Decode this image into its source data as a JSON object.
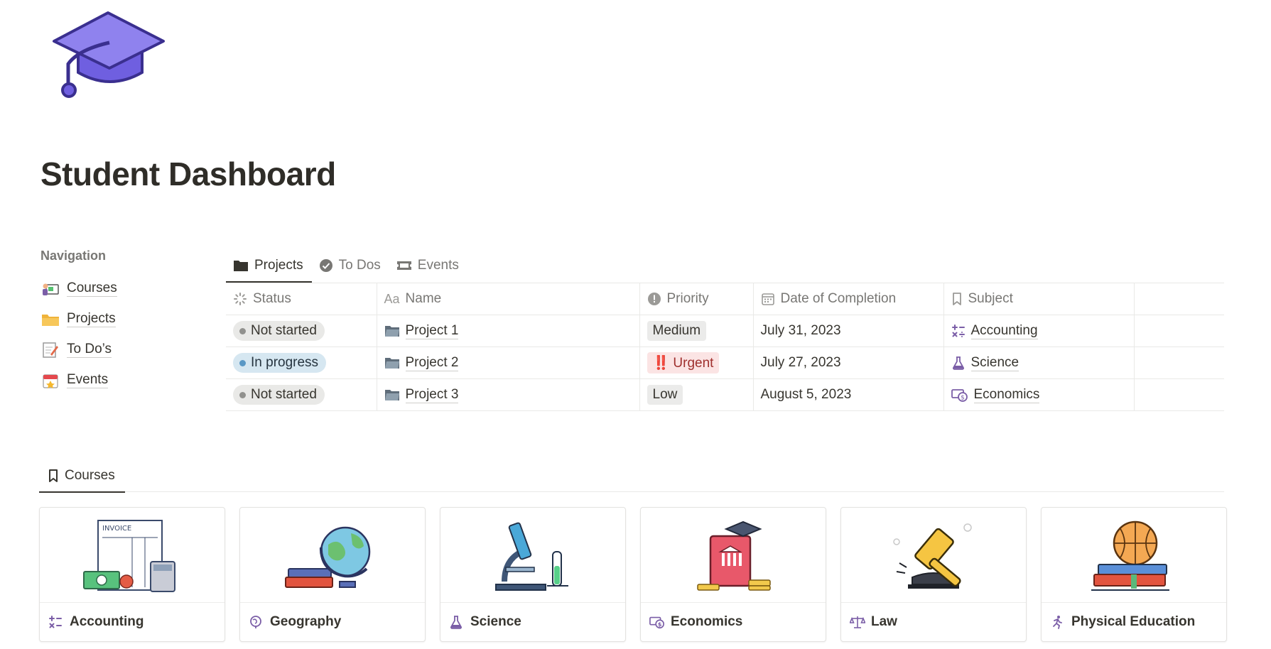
{
  "page": {
    "title": "Student Dashboard"
  },
  "navigation": {
    "heading": "Navigation",
    "items": [
      {
        "label": "Courses",
        "icon": "teacher-board-icon"
      },
      {
        "label": "Projects",
        "icon": "folder-icon"
      },
      {
        "label": "To Do’s",
        "icon": "memo-icon"
      },
      {
        "label": "Events",
        "icon": "calendar-icon"
      }
    ]
  },
  "tabs": [
    {
      "label": "Projects",
      "icon": "folder-icon",
      "active": true
    },
    {
      "label": "To Dos",
      "icon": "check-circle-icon",
      "active": false
    },
    {
      "label": "Events",
      "icon": "ticket-icon",
      "active": false
    }
  ],
  "table": {
    "columns": [
      "Status",
      "Name",
      "Priority",
      "Date of Completion",
      "Subject"
    ],
    "rows": [
      {
        "status": "Not started",
        "name": "Project 1",
        "priority": "Medium",
        "date": "July 31, 2023",
        "subject": "Accounting"
      },
      {
        "status": "In progress",
        "name": "Project 2",
        "priority": "‼️ Urgent",
        "date": "July 27, 2023",
        "subject": "Science"
      },
      {
        "status": "Not started",
        "name": "Project 3",
        "priority": "Low",
        "date": "August 5, 2023",
        "subject": "Economics"
      }
    ]
  },
  "courses": {
    "tab_label": "Courses",
    "cards": [
      {
        "label": "Accounting",
        "image": "invoice-calculator-illustration",
        "icon": "calculator-symbols-icon"
      },
      {
        "label": "Geography",
        "image": "globe-books-illustration",
        "icon": "globe-icon"
      },
      {
        "label": "Science",
        "image": "microscope-illustration",
        "icon": "flask-icon"
      },
      {
        "label": "Economics",
        "image": "bank-book-illustration",
        "icon": "money-icon"
      },
      {
        "label": "Law",
        "image": "gavel-illustration",
        "icon": "scales-icon"
      },
      {
        "label": "Physical Education",
        "image": "basketball-books-illustration",
        "icon": "running-icon"
      }
    ]
  },
  "colors": {
    "accent_purple": "#7b5ea7",
    "cap_purple": "#6c5ce7",
    "text": "#37352f",
    "muted": "#787774"
  }
}
